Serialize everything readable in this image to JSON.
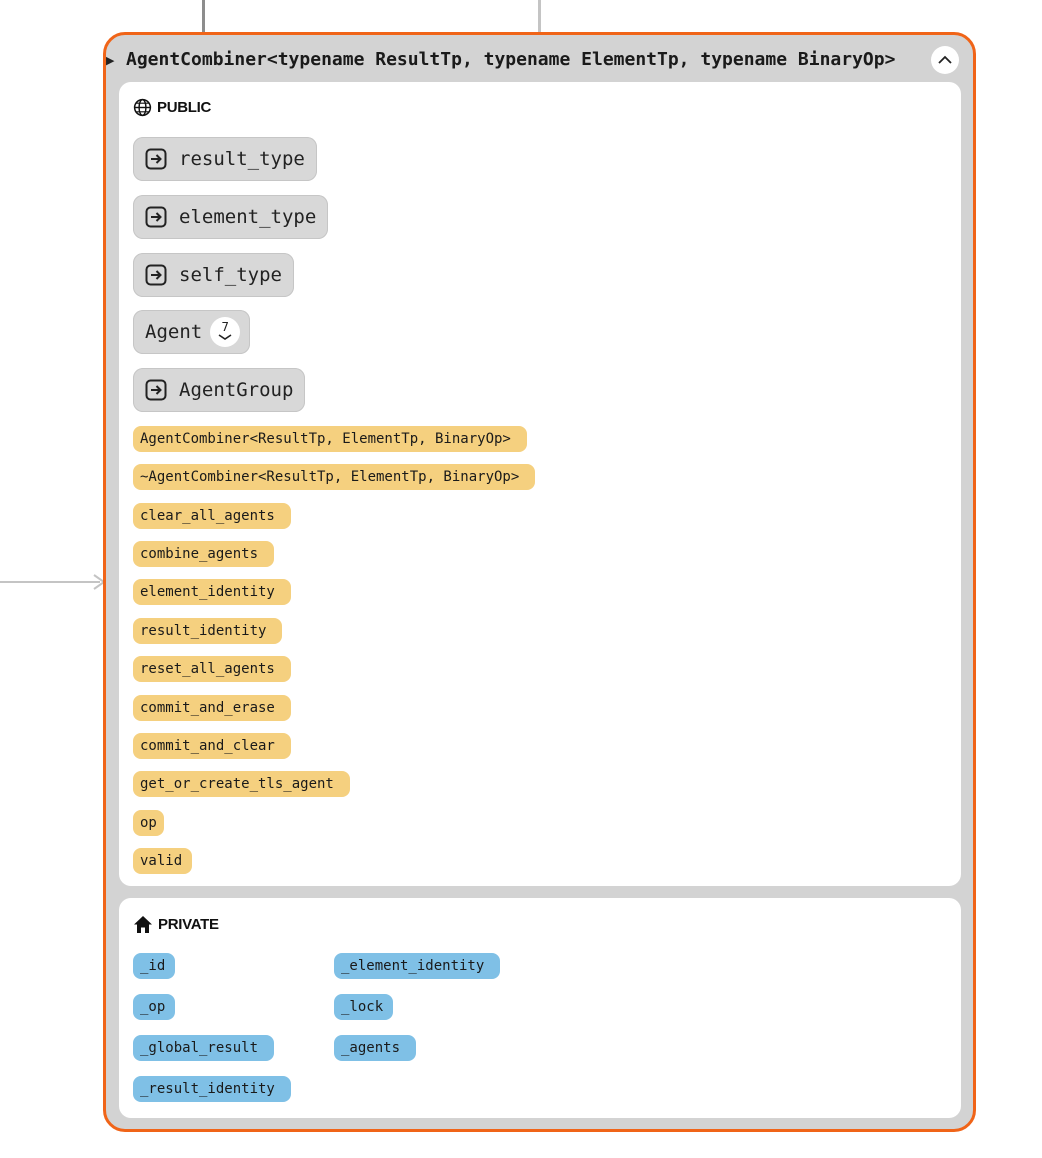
{
  "class_node": {
    "title": "AgentCombiner<typename ResultTp, typename ElementTp, typename BinaryOp>",
    "border_color": "#f06418",
    "expand_icon": "triangle-right-icon",
    "collapse_icon": "chevron-up-icon"
  },
  "public_section": {
    "label": "PUBLIC",
    "icon": "globe-icon",
    "types": [
      {
        "label": "result_type",
        "icon": "arrow-into-box-icon"
      },
      {
        "label": "element_type",
        "icon": "arrow-into-box-icon"
      },
      {
        "label": "self_type",
        "icon": "arrow-into-box-icon"
      }
    ],
    "agent": {
      "label": "Agent",
      "count": "7"
    },
    "agent_group": {
      "label": "AgentGroup",
      "icon": "arrow-into-box-icon"
    },
    "methods": [
      "AgentCombiner<ResultTp, ElementTp, BinaryOp>",
      "~AgentCombiner<ResultTp, ElementTp, BinaryOp>",
      "clear_all_agents",
      "combine_agents",
      "element_identity",
      "result_identity",
      "reset_all_agents",
      "commit_and_erase",
      "commit_and_clear",
      "get_or_create_tls_agent",
      "op",
      "valid"
    ],
    "method_color": "#f5d07f"
  },
  "private_section": {
    "label": "PRIVATE",
    "icon": "home-icon",
    "fields": [
      "_id",
      "_op",
      "_global_result",
      "_result_identity",
      "_element_identity",
      "_lock",
      "_agents"
    ],
    "field_color": "#7fc0e6"
  }
}
